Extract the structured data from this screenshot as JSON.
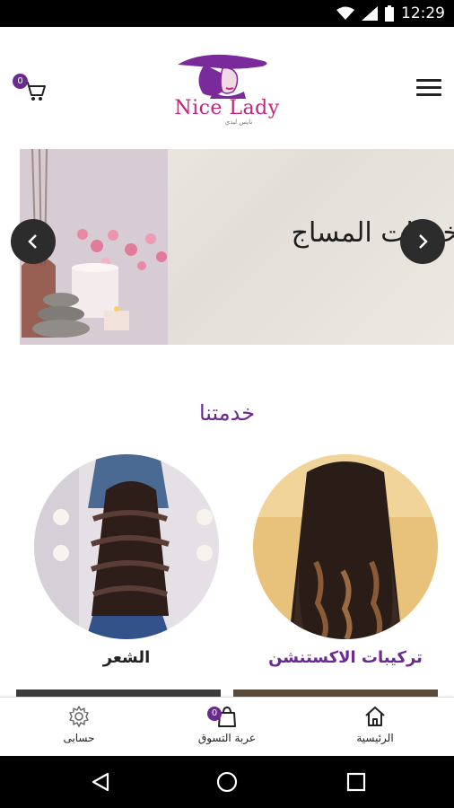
{
  "status_bar": {
    "time": "12:29",
    "icons": [
      "wifi-icon",
      "signal-icon",
      "battery-icon"
    ]
  },
  "header": {
    "logo_text": "Nice Lady",
    "logo_subtitle": "نايس ليدي",
    "cart_count": "0",
    "icons": [
      "cart-icon",
      "menu-icon"
    ]
  },
  "banner": {
    "title": "خدمات المساج",
    "icons": [
      "chevron-left-icon",
      "chevron-right-icon"
    ]
  },
  "services": {
    "title": "خدمتنا",
    "items": [
      {
        "label": "تركيبات الاكستنشن"
      },
      {
        "label": "الشعر"
      }
    ]
  },
  "bottom_nav": {
    "items": [
      {
        "label": "الرئيسية",
        "icon": "home-icon"
      },
      {
        "label": "عربة التسوق",
        "icon": "shopping-bag-icon"
      },
      {
        "label": "حسابى",
        "icon": "gear-icon"
      }
    ],
    "cart_count": "0"
  },
  "system_nav": {
    "icons": [
      "back-icon",
      "home-circle-icon",
      "recents-icon"
    ]
  },
  "colors": {
    "accent": "#6a2a8f",
    "logo_pink": "#c5237a"
  }
}
